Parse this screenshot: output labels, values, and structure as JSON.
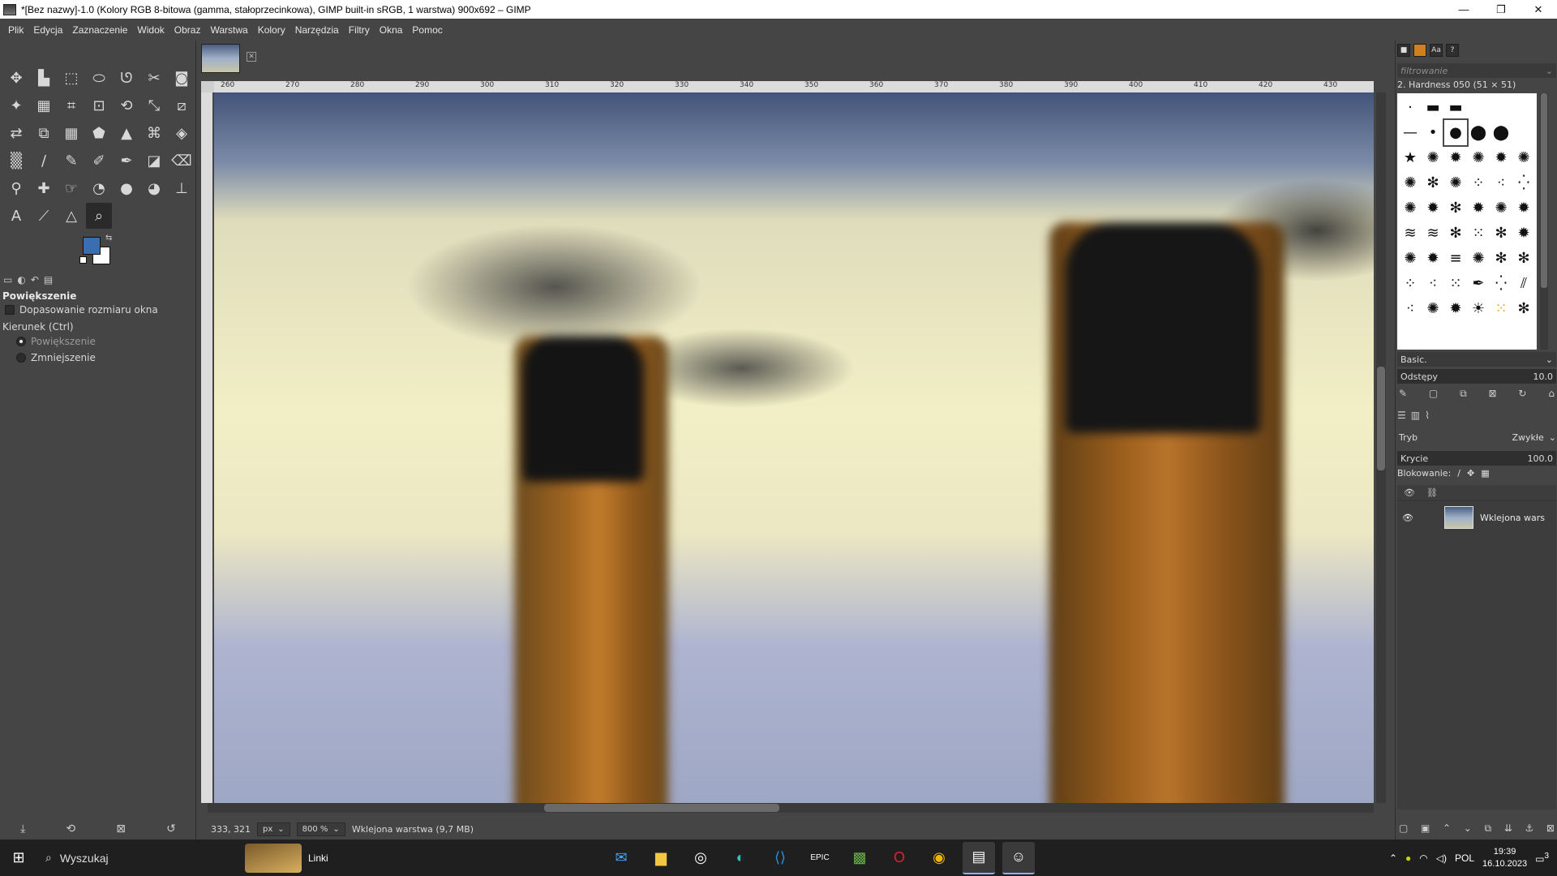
{
  "window": {
    "title": "*[Bez nazwy]-1.0 (Kolory RGB 8-bitowa (gamma, stałoprzecinkowa), GIMP built-in sRGB, 1 warstwa) 900x692 – GIMP",
    "minimize": "—",
    "maximize": "❐",
    "close": "✕"
  },
  "menu": [
    "Plik",
    "Edycja",
    "Zaznaczenie",
    "Widok",
    "Obraz",
    "Warstwa",
    "Kolory",
    "Narzędzia",
    "Filtry",
    "Okna",
    "Pomoc"
  ],
  "toolbox": {
    "tools": [
      {
        "name": "move-tool",
        "glyph": "✥"
      },
      {
        "name": "align-tool",
        "glyph": "▙"
      },
      {
        "name": "rect-select-tool",
        "glyph": "⬚"
      },
      {
        "name": "ellipse-select-tool",
        "glyph": "⬭"
      },
      {
        "name": "free-select-tool",
        "glyph": "ᘎ"
      },
      {
        "name": "scissors-tool",
        "glyph": "✂"
      },
      {
        "name": "foreground-select-tool",
        "glyph": "◙"
      },
      {
        "name": "fuzzy-select-tool",
        "glyph": "✦"
      },
      {
        "name": "color-select-tool",
        "glyph": "▦"
      },
      {
        "name": "crop-tool",
        "glyph": "⌗"
      },
      {
        "name": "unified-transform-tool",
        "glyph": "⊡"
      },
      {
        "name": "warp-transform-tool",
        "glyph": "⟲"
      },
      {
        "name": "scale-tool",
        "glyph": "⤡"
      },
      {
        "name": "shear-tool",
        "glyph": "⧄"
      },
      {
        "name": "flip-tool",
        "glyph": "⇄"
      },
      {
        "name": "perspective-tool",
        "glyph": "⧉"
      },
      {
        "name": "grid-tool",
        "glyph": "▦"
      },
      {
        "name": "cage-tool",
        "glyph": "⬟"
      },
      {
        "name": "bucket-fill-tool",
        "glyph": "▲"
      },
      {
        "name": "paths-tool",
        "glyph": "⌘"
      },
      {
        "name": "fill-tool",
        "glyph": "◈"
      },
      {
        "name": "gradient-tool",
        "glyph": "▒"
      },
      {
        "name": "paintbrush-tool",
        "glyph": "/"
      },
      {
        "name": "pencil-tool",
        "glyph": "✎"
      },
      {
        "name": "airbrush-tool",
        "glyph": "✐"
      },
      {
        "name": "ink-tool",
        "glyph": "✒"
      },
      {
        "name": "mypaint-tool",
        "glyph": "◪"
      },
      {
        "name": "eraser-tool",
        "glyph": "⌫"
      },
      {
        "name": "clone-tool",
        "glyph": "⚲"
      },
      {
        "name": "heal-tool",
        "glyph": "✚"
      },
      {
        "name": "smudge-tool",
        "glyph": "☞"
      },
      {
        "name": "blur-tool",
        "glyph": "◔"
      },
      {
        "name": "dodge-tool",
        "glyph": "●"
      },
      {
        "name": "dodge-burn-tool",
        "glyph": "◕"
      },
      {
        "name": "measure-tool",
        "glyph": "⊥"
      },
      {
        "name": "text-tool",
        "glyph": "A"
      },
      {
        "name": "color-picker-tool",
        "glyph": "⟋"
      },
      {
        "name": "measure-angle-tool",
        "glyph": "△"
      },
      {
        "name": "zoom-tool",
        "glyph": "⌕"
      }
    ],
    "options_title": "Powiększenie",
    "fit_window_label": "Dopasowanie rozmiaru okna",
    "direction_label": "Kierunek  (Ctrl)",
    "zoom_in_label": "Powiększenie",
    "zoom_out_label": "Zmniejszenie"
  },
  "ruler": {
    "ticks": [
      "260",
      "270",
      "280",
      "290",
      "300",
      "310",
      "320",
      "330",
      "340",
      "350",
      "360",
      "370",
      "380",
      "390",
      "400",
      "410",
      "420",
      "430"
    ]
  },
  "status": {
    "coords": "333, 321",
    "unit": "px",
    "zoom": "800 %",
    "layer_info": "Wklejona warstwa (9,7 MB)"
  },
  "brushes": {
    "filter_placeholder": "filtrowanie",
    "brush_name": "2. Hardness 050 (51 × 51)",
    "preset": "Basic.",
    "spacing_label": "Odstępy",
    "spacing_value": "10.0"
  },
  "layers": {
    "mode_label": "Tryb",
    "mode_value": "Zwykłe",
    "opacity_label": "Krycie",
    "opacity_value": "100.0",
    "lock_label": "Blokowanie:",
    "items": [
      {
        "name": "Wklejona wars"
      }
    ]
  },
  "taskbar": {
    "search": "Wyszukaj",
    "links": "Linki",
    "language": "POL",
    "time": "19:39",
    "date": "16.10.2023",
    "notification_count": "3"
  }
}
